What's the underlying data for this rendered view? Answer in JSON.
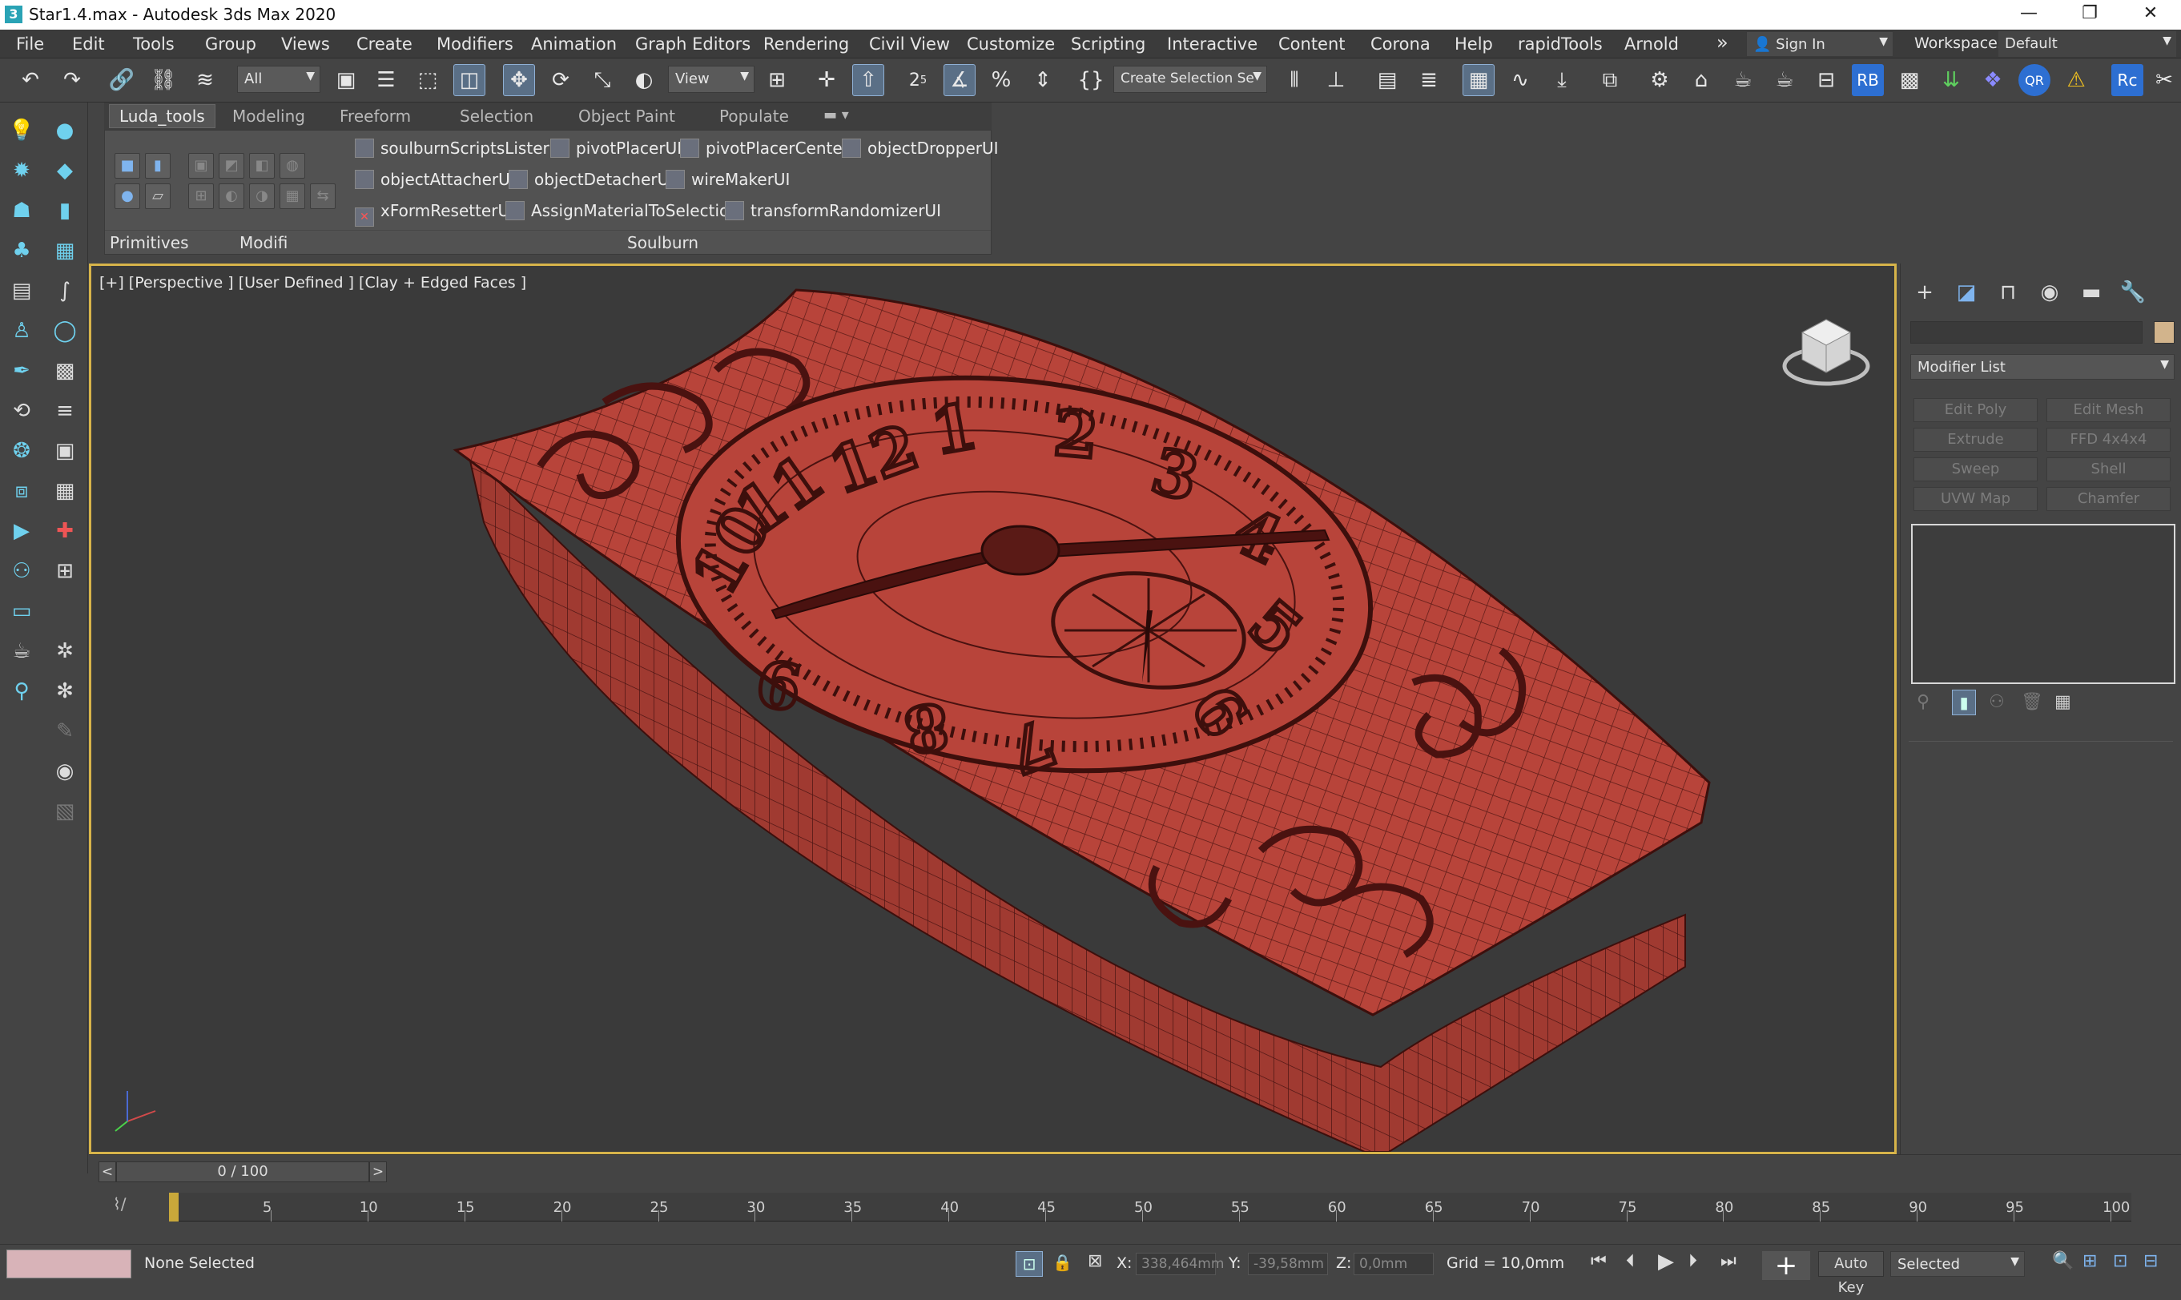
{
  "titlebar": {
    "title": "Star1.4.max - Autodesk 3ds Max 2020",
    "minimize": "—",
    "restore": "❐",
    "close": "✕"
  },
  "menu": [
    "File",
    "Edit",
    "Tools",
    "Group",
    "Views",
    "Create",
    "Modifiers",
    "Animation",
    "Graph Editors",
    "Rendering",
    "Civil View",
    "Customize",
    "Scripting",
    "Interactive",
    "Content",
    "Corona",
    "Help",
    "rapidTools",
    "Arnold"
  ],
  "menu_overflow": "»",
  "account": {
    "sign_in": "Sign In"
  },
  "workspaces": {
    "label": "Workspaces:",
    "value": "Default"
  },
  "main_toolbar": {
    "selection_filter": "All",
    "ref_coord": "View",
    "named_selection": "Create Selection Se",
    "snap_angle": "2.5",
    "percent_snap": "%",
    "rb_badge": "RB",
    "qr_badge": "QR",
    "rc_badge": "Rc"
  },
  "ribbon": {
    "tabs": [
      "Luda_tools",
      "Modeling",
      "Freeform",
      "Selection",
      "Object Paint",
      "Populate"
    ],
    "active_tab": "Luda_tools",
    "groups": {
      "primitives": "Primitives",
      "modifiers": "Modifi",
      "soulburn": "Soulburn"
    },
    "scripts": [
      "soulburnScriptsListerUI",
      "pivotPlacerUI",
      "pivotPlacerCenter",
      "objectDropperUI",
      "objectAttacherUI",
      "objectDetacherUI",
      "wireMakerUI",
      "xFormResetterUI",
      "AssignMaterialToSelection",
      "transformRandomizerUI"
    ]
  },
  "viewport": {
    "label": "[+] [Perspective ] [User Defined ] [Clay + Edged Faces ]",
    "model": "clock-box",
    "model_color": "#b8443a",
    "border_color": "#d7b44a",
    "dial_numerals": [
      "12",
      "1",
      "2",
      "3",
      "4",
      "5",
      "6",
      "7",
      "8",
      "9",
      "10",
      "11"
    ]
  },
  "command_panel": {
    "modifier_list": "Modifier List",
    "modifier_buttons": [
      "Edit Poly",
      "Edit Mesh",
      "Extrude",
      "FFD 4x4x4",
      "Sweep",
      "Shell",
      "UVW Map",
      "Chamfer"
    ]
  },
  "timeline": {
    "frame_counter": "0 / 100",
    "prev": "<",
    "next": ">",
    "ticks": [
      "5",
      "10",
      "15",
      "20",
      "25",
      "30",
      "35",
      "40",
      "45",
      "50",
      "55",
      "60",
      "65",
      "70",
      "75",
      "80",
      "85",
      "90",
      "95",
      "100"
    ]
  },
  "status": {
    "selection": "None Selected",
    "x_label": "X:",
    "x_value": "338,464mm",
    "y_label": "Y:",
    "y_value": "-39,58mm",
    "z_label": "Z:",
    "z_value": "0,0mm",
    "grid": "Grid = 10,0mm",
    "auto_key": "Auto Key",
    "key_filter": "Selected"
  }
}
